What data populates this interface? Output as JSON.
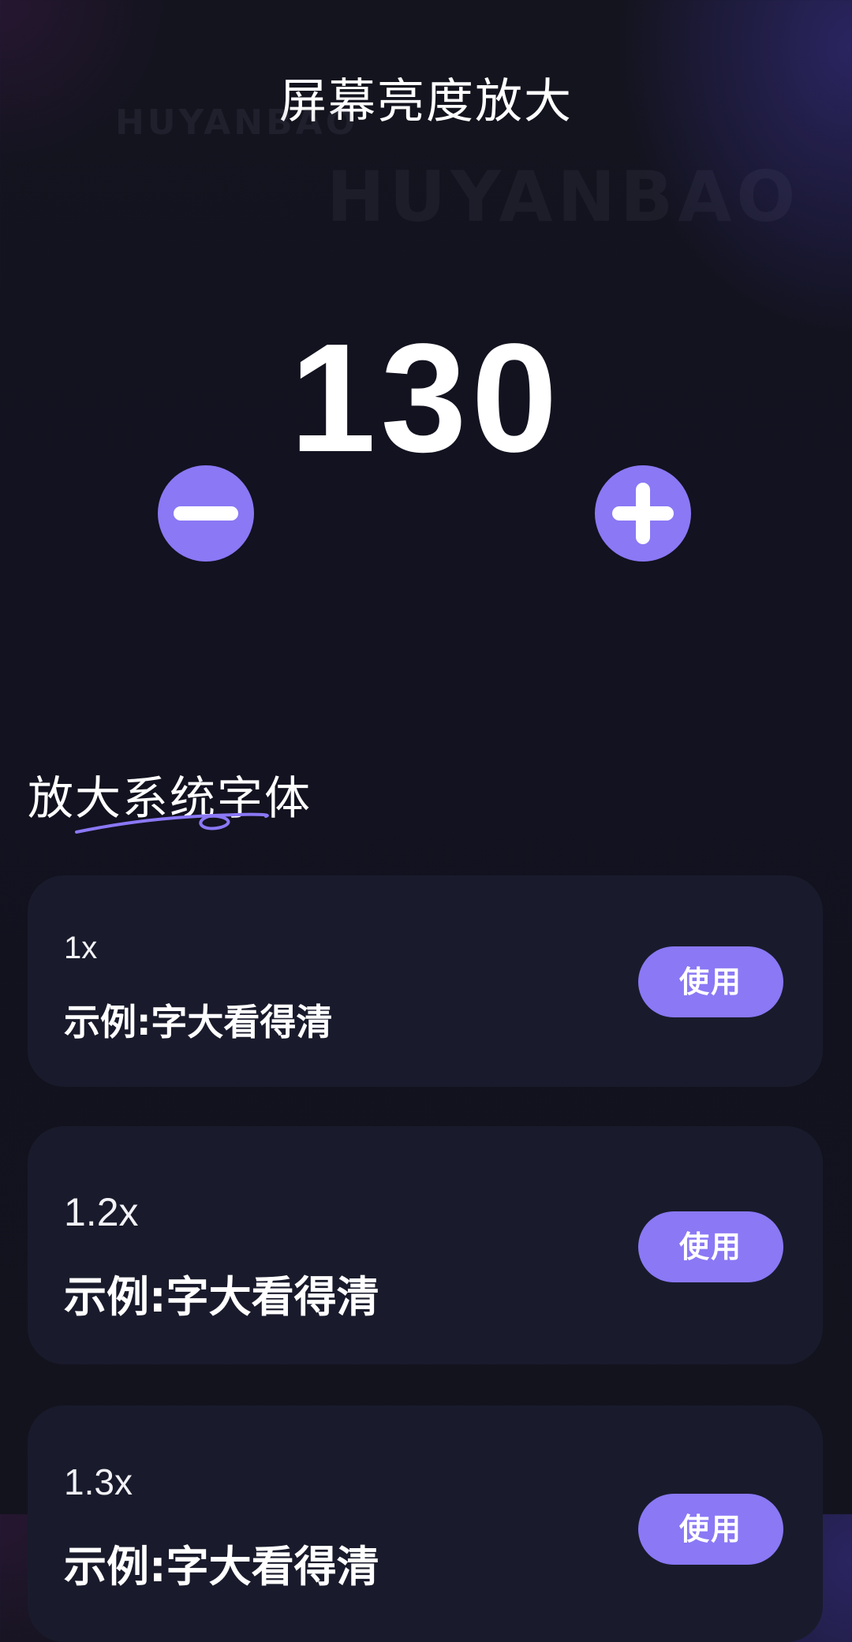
{
  "header": {
    "title": "屏幕亮度放大"
  },
  "watermark": {
    "text": "HUYANBAO"
  },
  "brightness": {
    "value": "130",
    "decrease_icon": "minus-icon",
    "increase_icon": "plus-icon"
  },
  "font_section": {
    "title": "放大系统字体",
    "options": [
      {
        "scale": "1x",
        "example": "示例:字大看得清",
        "button_label": "使用"
      },
      {
        "scale": "1.2x",
        "example": "示例:字大看得清",
        "button_label": "使用"
      },
      {
        "scale": "1.3x",
        "example": "示例:字大看得清",
        "button_label": "使用"
      }
    ]
  },
  "colors": {
    "accent": "#8a78f5",
    "background": "#14141f",
    "card": "#191b2c",
    "text": "#ffffff"
  }
}
